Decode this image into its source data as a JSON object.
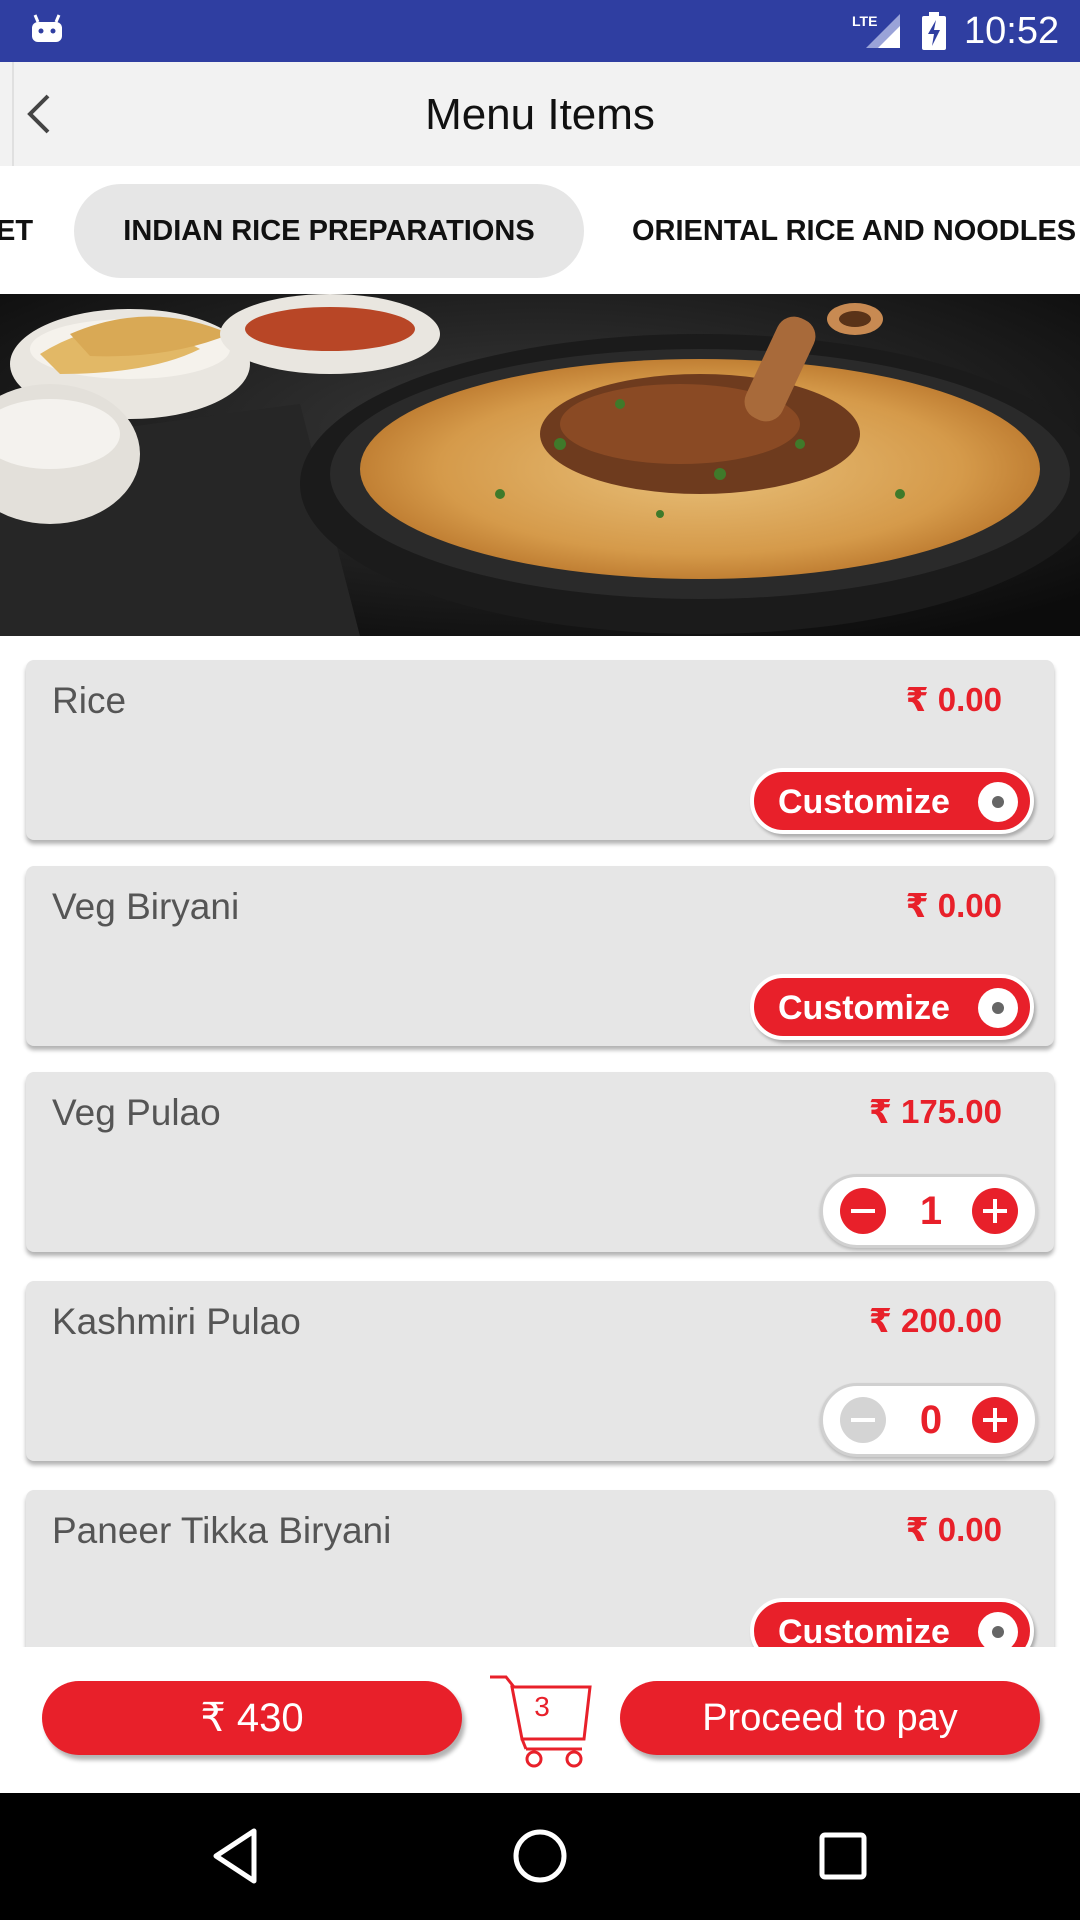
{
  "status_bar": {
    "time": "10:52",
    "network": "LTE"
  },
  "app_bar": {
    "title": "Menu Items",
    "back_icon": "back-arrow-icon"
  },
  "tabs": [
    {
      "label": "ET"
    },
    {
      "label": "INDIAN RICE PREPARATIONS",
      "selected": true
    },
    {
      "label": "ORIENTAL RICE AND NOODLES"
    }
  ],
  "items": [
    {
      "name": "Rice",
      "price": "₹ 0.00",
      "action": "customize",
      "button_label": "Customize"
    },
    {
      "name": "Veg Biryani",
      "price": "₹ 0.00",
      "action": "customize",
      "button_label": "Customize"
    },
    {
      "name": "Veg Pulao",
      "price": "₹ 175.00",
      "action": "stepper",
      "quantity": "1"
    },
    {
      "name": "Kashmiri Pulao",
      "price": "₹ 200.00",
      "action": "stepper",
      "quantity": "0"
    },
    {
      "name": "Paneer Tikka Biryani",
      "price": "₹ 0.00",
      "action": "customize",
      "button_label": "Customize"
    }
  ],
  "footer": {
    "total_label": "₹  430",
    "cart_count": "3",
    "pay_label": "Proceed to pay"
  },
  "colors": {
    "accent": "#e8202a",
    "status_bar": "#2f3ea1",
    "card_bg": "#e6e6e6"
  }
}
